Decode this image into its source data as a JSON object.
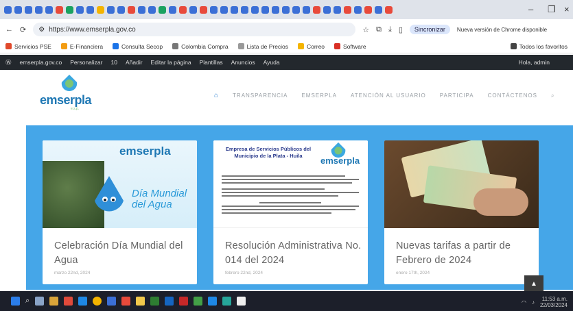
{
  "browser": {
    "url": "https://www.emserpla.gov.co",
    "sync_label": "Sincronizar",
    "update_label": "Nueva versión de Chrome disponible",
    "bookmarks": [
      {
        "label": "Servicios PSE",
        "color": "#e0492b"
      },
      {
        "label": "E-Financiera",
        "color": "#f39c12"
      },
      {
        "label": "Consulta Secop",
        "color": "#1a73e8"
      },
      {
        "label": "Colombia Compra",
        "color": "#777777"
      },
      {
        "label": "Lista de Precios",
        "color": "#999999"
      },
      {
        "label": "Correo",
        "color": "#f4b400"
      },
      {
        "label": "Software",
        "color": "#d93025"
      },
      {
        "label": "Todos los favoritos",
        "color": "#444444"
      }
    ],
    "admin_bar": [
      "emserpla.gov.co",
      "Personalizar",
      "10",
      "Añadir",
      "Editar la página",
      "Plantillas",
      "Anuncios",
      "Ayuda"
    ],
    "admin_user": "Hola, admin"
  },
  "site": {
    "logo_text": "emserpla",
    "logo_sub": "e.s.p.",
    "nav": [
      "TRANSPARENCIA",
      "EMSERPLA",
      "ATENCIÓN AL USUARIO",
      "PARTICIPA",
      "CONTÁCTENOS"
    ],
    "home_icon": "home-icon",
    "search_icon": "search-icon",
    "accent": "#45a6e8"
  },
  "cards": [
    {
      "title": "Celebración Día Mundial del Agua",
      "date": "marzo 22nd, 2024",
      "image_caption": "Día Mundial del Agua",
      "image_brand": "emserpla"
    },
    {
      "title": "Resolución Administrativa No. 014 del 2024",
      "date": "febrero 22nd, 2024",
      "doc_header": "Empresa de Servicios Públicos del Municipio de la Plata - Huila"
    },
    {
      "title": "Nuevas tarifas a partir de Febrero de 2024",
      "date": "enero 17th, 2024"
    }
  ],
  "taskbar": {
    "clock": "11:53 a.m.",
    "date": "22/03/2024"
  }
}
